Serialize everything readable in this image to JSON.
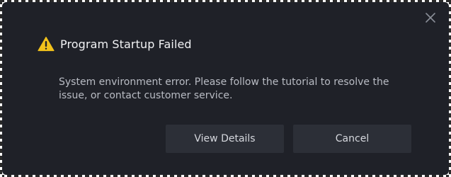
{
  "dialog": {
    "title": "Program Startup Failed",
    "message": "System environment error. Please follow the tutorial to resolve the issue, or contact customer service.",
    "buttons": {
      "details_label": "View Details",
      "cancel_label": "Cancel"
    },
    "icons": {
      "warning": "warning-triangle-icon",
      "close": "close-icon"
    },
    "colors": {
      "background": "#1f2128",
      "button": "#2c2f37",
      "warning": "#f2c21b"
    }
  }
}
